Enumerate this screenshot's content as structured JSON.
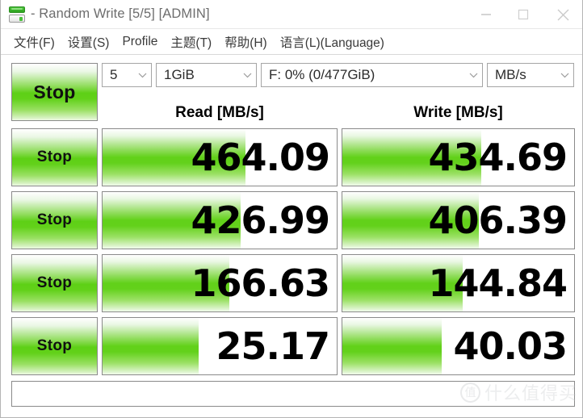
{
  "window": {
    "title": "- Random Write [5/5] [ADMIN]",
    "icon": "crystaldiskmark-icon",
    "controls": {
      "minimize": "minimize-icon",
      "maximize": "maximize-icon",
      "close": "close-icon"
    }
  },
  "menubar": {
    "items": [
      {
        "label": "文件(F)",
        "name": "menu-file"
      },
      {
        "label": "设置(S)",
        "name": "menu-settings"
      },
      {
        "label": "Profile",
        "name": "menu-profile"
      },
      {
        "label": "主题(T)",
        "name": "menu-theme"
      },
      {
        "label": "帮助(H)",
        "name": "menu-help"
      },
      {
        "label": "语言(L)(Language)",
        "name": "menu-language"
      }
    ]
  },
  "toolbar": {
    "all_button_label": "Stop",
    "test_count": "5",
    "test_size": "1GiB",
    "target_drive": "F: 0% (0/477GiB)",
    "unit": "MB/s",
    "chevron": "⌄"
  },
  "headers": {
    "read": "Read [MB/s]",
    "write": "Write [MB/s]"
  },
  "rows": [
    {
      "name": "row-seq1m-q8t1",
      "button_label": "Stop",
      "read_value": "464.09",
      "write_value": "434.69",
      "read_fill_pct": 61,
      "write_fill_pct": 60
    },
    {
      "name": "row-seq1m-q1t1",
      "button_label": "Stop",
      "read_value": "426.99",
      "write_value": "406.39",
      "read_fill_pct": 59,
      "write_fill_pct": 59
    },
    {
      "name": "row-rnd4k-q32t1",
      "button_label": "Stop",
      "read_value": "166.63",
      "write_value": "144.84",
      "read_fill_pct": 54,
      "write_fill_pct": 52
    },
    {
      "name": "row-rnd4k-q1t1",
      "button_label": "Stop",
      "read_value": "25.17",
      "write_value": "40.03",
      "read_fill_pct": 41,
      "write_fill_pct": 43
    }
  ],
  "statusbar": {
    "text": ""
  },
  "watermark": {
    "logo": "值",
    "text": "什么值得买"
  },
  "colors": {
    "green_mid": "#62d119",
    "green_light": "#9ae063",
    "border": "#8a8a8a",
    "title_text": "#6d6d6d"
  }
}
